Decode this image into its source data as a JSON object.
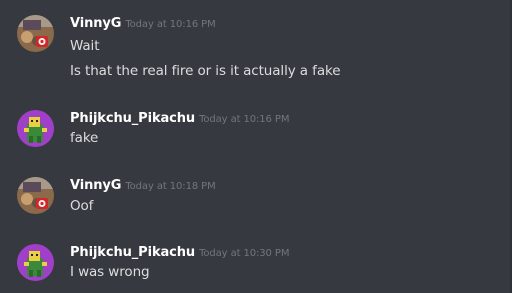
{
  "messages": [
    {
      "author": "VinnyG",
      "timestamp": "Today at 10:16 PM",
      "avatar_icon": "vinnyg-avatar-icon",
      "lines": [
        "Wait",
        "Is that the real fire or is it actually a fake"
      ]
    },
    {
      "author": "Phijkchu_Pikachu",
      "timestamp": "Today at 10:16 PM",
      "avatar_icon": "phijkchu-avatar-icon",
      "lines": [
        "fake"
      ]
    },
    {
      "author": "VinnyG",
      "timestamp": "Today at 10:18 PM",
      "avatar_icon": "vinnyg-avatar-icon",
      "lines": [
        "Oof"
      ]
    },
    {
      "author": "Phijkchu_Pikachu",
      "timestamp": "Today at 10:30 PM",
      "avatar_icon": "phijkchu-avatar-icon",
      "lines": [
        "I was wrong"
      ]
    }
  ],
  "colors": {
    "background": "#36393f",
    "username": "#ffffff",
    "message_text": "#dcddde",
    "timestamp": "#72767d"
  }
}
